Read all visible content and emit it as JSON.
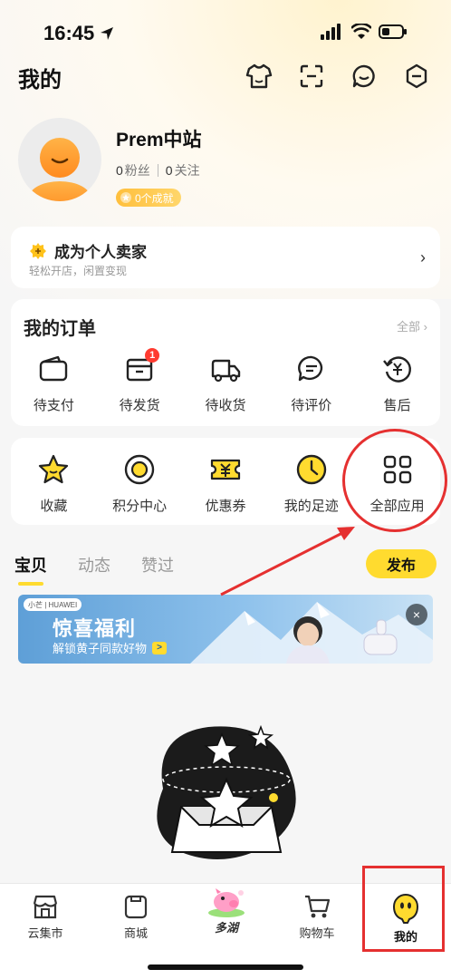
{
  "status_bar": {
    "time": "16:45"
  },
  "header": {
    "title": "我的",
    "icons": [
      "shirt-icon",
      "scan-icon",
      "chat-icon",
      "settings-icon"
    ]
  },
  "profile": {
    "name": "Prem中站",
    "fans_count": "0",
    "fans_label": "粉丝",
    "follow_count": "0",
    "follow_label": "关注",
    "achievements": "0个成就"
  },
  "seller": {
    "title": "成为个人卖家",
    "subtitle": "轻松开店，闲置变现"
  },
  "orders": {
    "title": "我的订单",
    "all_label": "全部 ›",
    "items": [
      {
        "label": "待支付",
        "icon": "wallet-icon"
      },
      {
        "label": "待发货",
        "icon": "box-icon",
        "badge": "1"
      },
      {
        "label": "待收货",
        "icon": "truck-icon"
      },
      {
        "label": "待评价",
        "icon": "comment-icon"
      },
      {
        "label": "售后",
        "icon": "refund-icon"
      }
    ]
  },
  "apps": {
    "items": [
      {
        "label": "收藏",
        "icon": "star-icon"
      },
      {
        "label": "积分中心",
        "icon": "points-icon"
      },
      {
        "label": "优惠券",
        "icon": "coupon-icon"
      },
      {
        "label": "我的足迹",
        "icon": "clock-icon"
      },
      {
        "label": "全部应用",
        "icon": "grid-icon"
      }
    ]
  },
  "content_tabs": {
    "tabs": [
      "宝贝",
      "动态",
      "赞过"
    ],
    "active": "宝贝",
    "publish_label": "发布"
  },
  "banner": {
    "tag": "小芒 | HUAWEI",
    "title": "惊喜福利",
    "subtitle": "解锁黄子同款好物",
    "go": ">",
    "close": "×"
  },
  "tabbar": {
    "items": [
      {
        "label": "云集市",
        "icon": "market-icon"
      },
      {
        "label": "商城",
        "icon": "mall-icon"
      },
      {
        "label": "多湖",
        "icon": "pig-icon"
      },
      {
        "label": "购物车",
        "icon": "cart-icon"
      },
      {
        "label": "我的",
        "icon": "mascot-icon"
      }
    ],
    "active": "我的"
  },
  "colors": {
    "accent": "#ffdb2f",
    "annotation": "#e53030",
    "badge_red": "#ff3b30"
  }
}
